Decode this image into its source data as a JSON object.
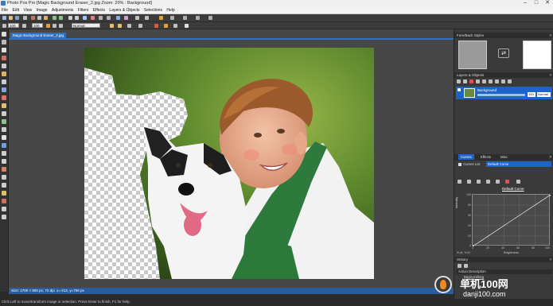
{
  "window": {
    "title": "Photo Pos Pro [Magic Background Eraser_2.jpg Zoom: 20% : Background]",
    "controls": [
      "–",
      "□",
      "✕"
    ]
  },
  "menu": [
    "File",
    "Edit",
    "View",
    "Image",
    "Adjustments",
    "Filters",
    "Effects",
    "Layers & Objects",
    "Selections",
    "Help"
  ],
  "toolbar2": {
    "zoom_value": "100",
    "opacity_value": "100",
    "blend_mode": "Normal"
  },
  "document": {
    "tab_label": "Magic Background Eraser_2.jpg"
  },
  "status": {
    "size": "Size: 1700 × 900 px, 72 dpi",
    "position": "x=-212, y=756 px",
    "hint": "Click Left to move/transform image or selection. Press Enter to finish, F1 for help."
  },
  "fore_back": {
    "title": "Fore/Back Styles",
    "fore_color": "#9a9a9a",
    "back_color": "#ffffff"
  },
  "layers": {
    "title": "Layers & Objects",
    "layer_name": "Background",
    "opacity": "100",
    "blend": "Normal"
  },
  "curves": {
    "tabs": [
      "Curves",
      "Effects",
      "Misc"
    ],
    "list_label": "Curves List",
    "list_value": "Default Curve",
    "curve_name": "Default Curve",
    "coords": "X=0, Y=0",
    "x_axis_label": "Brightness",
    "y_axis_label": "Intensity",
    "x_ticks": [
      "0",
      "20",
      "40",
      "60",
      "80",
      "100"
    ],
    "y_ticks": [
      "100",
      "80",
      "60",
      "40",
      "20",
      "0"
    ]
  },
  "history": {
    "title": "History",
    "header": "Action Description",
    "item": "Begin Editing"
  },
  "watermark": {
    "cn": "单机100网",
    "url": "danji100.com"
  },
  "colors": {
    "accent": "#1e64c8",
    "panel": "#3a3a3a"
  }
}
